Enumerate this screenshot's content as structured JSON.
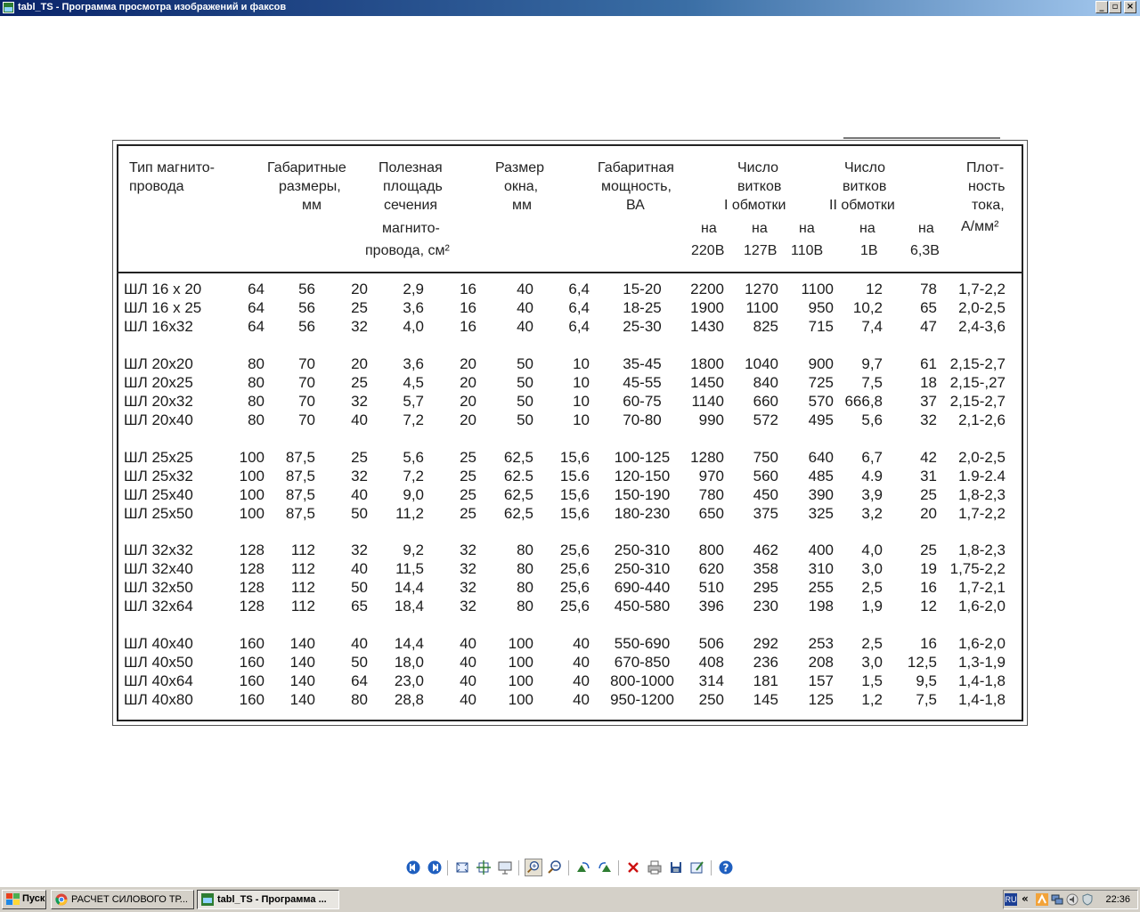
{
  "window": {
    "title": "tabl_TS - Программа просмотра изображений и факсов",
    "minimize_glyph": "_",
    "maximize_glyph": "▫",
    "close_glyph": "×"
  },
  "table": {
    "headers": {
      "type_1": "Тип магнито-",
      "type_2": "провода",
      "gab_1": "Габаритные",
      "gab_2": "размеры,",
      "gab_3": "мм",
      "area_1": "Полезная",
      "area_2": "площадь",
      "area_3": "сечения",
      "area_4": "магнито-",
      "area_5": "провода, см²",
      "win_1": "Размер",
      "win_2": "окна,",
      "win_3": "мм",
      "pow_1": "Габаритная",
      "pow_2": "мощность,",
      "pow_3": "ВА",
      "t1_1": "Число",
      "t1_2": "витков",
      "t1_3": "I обмотки",
      "t2_1": "Число",
      "t2_2": "витков",
      "t2_3": "II обмотки",
      "den_1": "Плот-",
      "den_2": "ность",
      "den_3": "тока,",
      "den_4": "А/мм²",
      "na": "на",
      "v220": "220В",
      "v127": "127В",
      "v110": "110В",
      "v1": "1В",
      "v63": "6,3В"
    },
    "rows": [
      [
        "ШЛ 16 х 20",
        "64",
        "56",
        "20",
        "2,9",
        "16",
        "40",
        "6,4",
        "15-20",
        "2200",
        "1270",
        "1100",
        "12",
        "78",
        "1,7-2,2"
      ],
      [
        "ШЛ 16 х 25",
        "64",
        "56",
        "25",
        "3,6",
        "16",
        "40",
        "6,4",
        "18-25",
        "1900",
        "1100",
        "950",
        "10,2",
        "65",
        "2,0-2,5"
      ],
      [
        "ШЛ 16х32",
        "64",
        "56",
        "32",
        "4,0",
        "16",
        "40",
        "6,4",
        "25-30",
        "1430",
        "825",
        "715",
        "7,4",
        "47",
        "2,4-3,6"
      ],
      [
        "ШЛ 20х20",
        "80",
        "70",
        "20",
        "3,6",
        "20",
        "50",
        "10",
        "35-45",
        "1800",
        "1040",
        "900",
        "9,7",
        "61",
        "2,15-2,7"
      ],
      [
        "ШЛ 20х25",
        "80",
        "70",
        "25",
        "4,5",
        "20",
        "50",
        "10",
        "45-55",
        "1450",
        "840",
        "725",
        "7,5",
        "18",
        "2,15-,27"
      ],
      [
        "ШЛ 20х32",
        "80",
        "70",
        "32",
        "5,7",
        "20",
        "50",
        "10",
        "60-75",
        "1140",
        "660",
        "570",
        "666,8",
        "37",
        "2,15-2,7"
      ],
      [
        "ШЛ 20х40",
        "80",
        "70",
        "40",
        "7,2",
        "20",
        "50",
        "10",
        "70-80",
        "990",
        "572",
        "495",
        "5,6",
        "32",
        "2,1-2,6"
      ],
      [
        "ШЛ 25х25",
        "100",
        "87,5",
        "25",
        "5,6",
        "25",
        "62,5",
        "15,6",
        "100-125",
        "1280",
        "750",
        "640",
        "6,7",
        "42",
        "2,0-2,5"
      ],
      [
        "ШЛ 25х32",
        "100",
        "87,5",
        "32",
        "7,2",
        "25",
        "62.5",
        "15.6",
        "120-150",
        "970",
        "560",
        "485",
        "4.9",
        "31",
        "1.9-2.4"
      ],
      [
        "ШЛ 25х40",
        "100",
        "87,5",
        "40",
        "9,0",
        "25",
        "62,5",
        "15,6",
        "150-190",
        "780",
        "450",
        "390",
        "3,9",
        "25",
        "1,8-2,3"
      ],
      [
        "ШЛ 25х50",
        "100",
        "87,5",
        "50",
        "11,2",
        "25",
        "62,5",
        "15,6",
        "180-230",
        "650",
        "375",
        "325",
        "3,2",
        "20",
        "1,7-2,2"
      ],
      [
        "ШЛ 32х32",
        "128",
        "112",
        "32",
        "9,2",
        "32",
        "80",
        "25,6",
        "250-310",
        "800",
        "462",
        "400",
        "4,0",
        "25",
        "1,8-2,3"
      ],
      [
        "ШЛ 32х40",
        "128",
        "112",
        "40",
        "11,5",
        "32",
        "80",
        "25,6",
        "250-310",
        "620",
        "358",
        "310",
        "3,0",
        "19",
        "1,75-2,2"
      ],
      [
        "ШЛ 32х50",
        "128",
        "112",
        "50",
        "14,4",
        "32",
        "80",
        "25,6",
        "690-440",
        "510",
        "295",
        "255",
        "2,5",
        "16",
        "1,7-2,1"
      ],
      [
        "ШЛ 32х64",
        "128",
        "112",
        "65",
        "18,4",
        "32",
        "80",
        "25,6",
        "450-580",
        "396",
        "230",
        "198",
        "1,9",
        "12",
        "1,6-2,0"
      ],
      [
        "ШЛ 40х40",
        "160",
        "140",
        "40",
        "14,4",
        "40",
        "100",
        "40",
        "550-690",
        "506",
        "292",
        "253",
        "2,5",
        "16",
        "1,6-2,0"
      ],
      [
        "ШЛ 40х50",
        "160",
        "140",
        "50",
        "18,0",
        "40",
        "100",
        "40",
        "670-850",
        "408",
        "236",
        "208",
        "3,0",
        "12,5",
        "1,3-1,9"
      ],
      [
        "ШЛ 40х64",
        "160",
        "140",
        "64",
        "23,0",
        "40",
        "100",
        "40",
        "800-1000",
        "314",
        "181",
        "157",
        "1,5",
        "9,5",
        "1,4-1,8"
      ],
      [
        "ШЛ 40х80",
        "160",
        "140",
        "80",
        "28,8",
        "40",
        "100",
        "40",
        "950-1200",
        "250",
        "145",
        "125",
        "1,2",
        "7,5",
        "1,4-1,8"
      ]
    ]
  },
  "toolbar": {
    "buttons": [
      {
        "name": "previous-image-icon"
      },
      {
        "name": "next-image-icon"
      },
      {
        "name": "best-fit-icon"
      },
      {
        "name": "actual-size-icon"
      },
      {
        "name": "slideshow-icon"
      },
      {
        "name": "zoom-in-icon"
      },
      {
        "name": "zoom-out-icon"
      },
      {
        "name": "rotate-clockwise-icon"
      },
      {
        "name": "rotate-counterclockwise-icon"
      },
      {
        "name": "delete-icon"
      },
      {
        "name": "print-icon"
      },
      {
        "name": "save-icon"
      },
      {
        "name": "edit-icon"
      },
      {
        "name": "help-icon"
      }
    ]
  },
  "taskbar": {
    "start_label": "Пуск",
    "tasks": [
      {
        "label": "РАСЧЕТ СИЛОВОГО ТР..."
      },
      {
        "label": "tabl_TS - Программа ..."
      }
    ],
    "lang": "RU",
    "chevron": "«",
    "clock": "22:36"
  },
  "colors": {
    "title_start": "#0a246a",
    "title_end": "#a6caf0",
    "delete_red": "#cc1111",
    "nav_blue": "#1f5fbf"
  }
}
